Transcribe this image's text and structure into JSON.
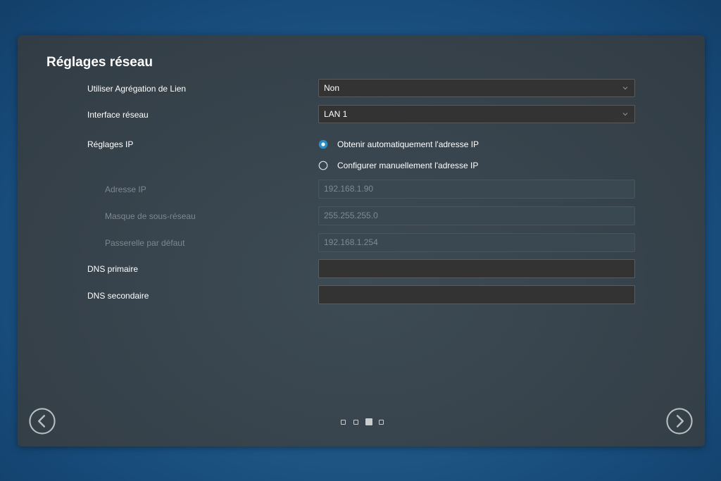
{
  "title": "Réglages réseau",
  "link_aggregation": {
    "label": "Utiliser Agrégation de Lien",
    "value": "Non"
  },
  "network_interface": {
    "label": "Interface réseau",
    "value": "LAN 1"
  },
  "ip_settings": {
    "label": "Réglages IP",
    "options": [
      {
        "label": "Obtenir automatiquement l'adresse IP",
        "selected": true
      },
      {
        "label": "Configurer manuellement l'adresse IP",
        "selected": false
      }
    ]
  },
  "ip_address": {
    "label": "Adresse IP",
    "value": "192.168.1.90"
  },
  "subnet_mask": {
    "label": "Masque de sous-réseau",
    "value": "255.255.255.0"
  },
  "gateway": {
    "label": "Passerelle par défaut",
    "value": "192.168.1.254"
  },
  "dns_primary": {
    "label": "DNS primaire",
    "value": ""
  },
  "dns_secondary": {
    "label": "DNS secondaire",
    "value": ""
  },
  "pagination": {
    "current_page": 3,
    "total_pages": 4
  },
  "colors": {
    "radio_accent": "#2a8cc4",
    "panel_bg": "#37434c",
    "field_bg": "#333333"
  },
  "icons": {
    "prev": "chevron-left-circle-icon",
    "next": "chevron-right-circle-icon",
    "dropdown": "chevron-down-icon"
  }
}
